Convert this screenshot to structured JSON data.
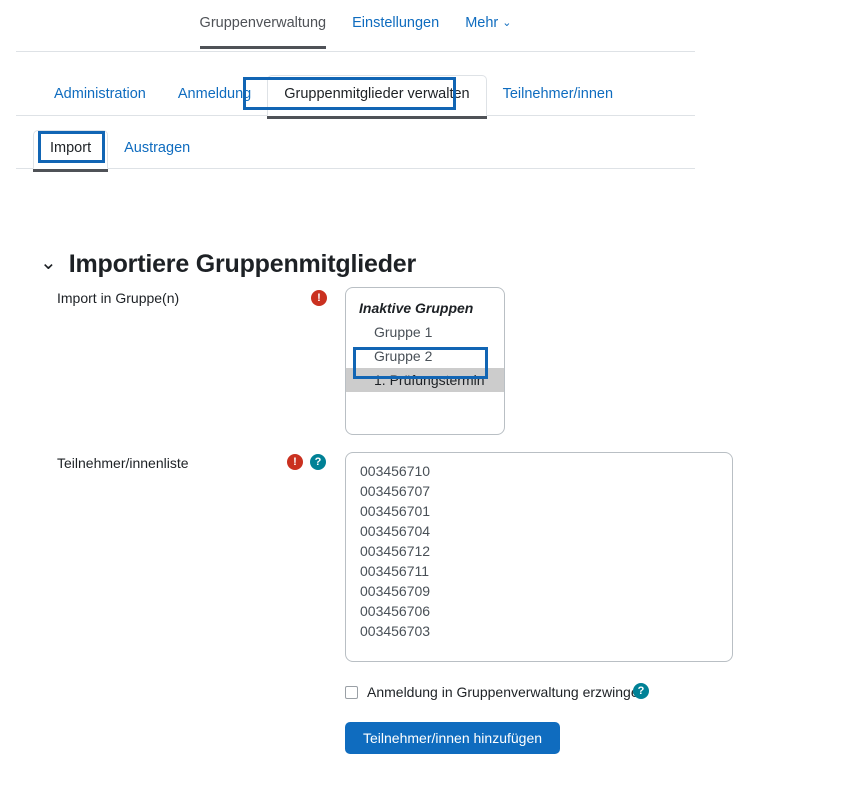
{
  "nav_primary": {
    "items": [
      {
        "label": "Gruppenverwaltung",
        "active": true,
        "has_caret": false
      },
      {
        "label": "Einstellungen",
        "active": false,
        "has_caret": false
      },
      {
        "label": "Mehr",
        "active": false,
        "has_caret": true
      }
    ],
    "caret_glyph": "⌄"
  },
  "nav_secondary": {
    "items": [
      {
        "label": "Administration",
        "active": false
      },
      {
        "label": "Anmeldung",
        "active": false
      },
      {
        "label": "Gruppenmitglieder verwalten",
        "active": true
      },
      {
        "label": "Teilnehmer/innen",
        "active": false
      }
    ]
  },
  "nav_tertiary": {
    "items": [
      {
        "label": "Import",
        "active": true
      },
      {
        "label": "Austragen",
        "active": false
      }
    ]
  },
  "section": {
    "collapse_icon": "chevron-down-icon",
    "collapse_glyph": "⌄",
    "title": "Importiere Gruppenmitglieder"
  },
  "form": {
    "group_field": {
      "label": "Import in Gruppe(n)",
      "required_icon": "!",
      "optgroup_label": "Inaktive Gruppen",
      "options": [
        {
          "label": "Gruppe 1",
          "selected": false
        },
        {
          "label": "Gruppe 2",
          "selected": false
        },
        {
          "label": "1. Prüfungstermin",
          "selected": true
        }
      ]
    },
    "participant_list": {
      "label": "Teilnehmer/innenliste",
      "required_icon": "!",
      "help_icon": "?",
      "value_lines": [
        "003456710",
        "003456707",
        "003456701",
        "003456704",
        "003456712",
        "003456711",
        "003456709",
        "003456706",
        "003456703"
      ]
    },
    "force_checkbox": {
      "label": "Anmeldung in Gruppenverwaltung erzwingen",
      "checked": false,
      "help_icon": "?"
    },
    "submit_button": {
      "label": "Teilnehmer/innen hinzufügen"
    }
  },
  "colors": {
    "link": "#0f6cbf",
    "primary_button": "#0f6cbf",
    "required_badge": "#ca3120",
    "help_badge": "#008196",
    "annotation": "#1165b4",
    "selected_option": "#cccccc",
    "active_tab_underline": "#4f5257"
  }
}
